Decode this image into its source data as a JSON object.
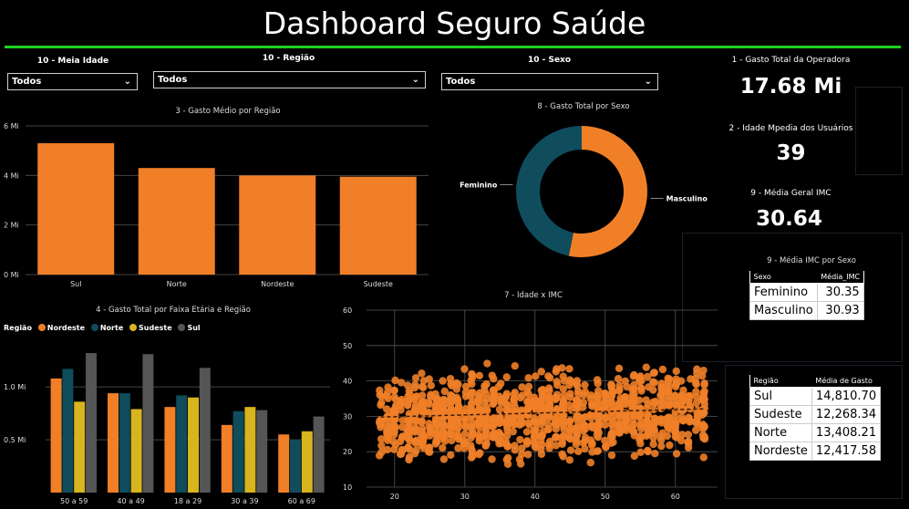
{
  "header": {
    "title": "Dashboard Seguro Saúde"
  },
  "colors": {
    "accent_line": "#20d020",
    "orange": "#f07f28",
    "teal": "#0f4c5c",
    "gold": "#d8b41e",
    "gray": "#555555"
  },
  "slicers": [
    {
      "label": "10 - Meia Idade",
      "value": "Todos"
    },
    {
      "label": "10 - Região",
      "value": "Todos"
    },
    {
      "label": "10 - Sexo",
      "value": "Todos"
    }
  ],
  "cards": [
    {
      "label": "1 - Gasto Total da Operadora",
      "value": "17.68 Mi"
    },
    {
      "label": "2 - Idade Mpedia dos Usuários",
      "value": "39"
    },
    {
      "label": "9 - Média Geral IMC",
      "value": "30.64"
    }
  ],
  "charts": {
    "region_avg": {
      "title": "3 - Gasto Médio por Região"
    },
    "sex_total": {
      "title": "8 - Gasto Total por Sexo"
    },
    "age_region": {
      "title": "4 - Gasto Total por Faixa Etária e Região",
      "legend_title": "Região"
    },
    "scatter": {
      "title": "7 - Idade x IMC"
    }
  },
  "tables": {
    "imc_sexo": {
      "title": "9 - Média IMC por Sexo",
      "headers": [
        "Sexo",
        "Média_IMC"
      ],
      "rows": [
        [
          "Feminino",
          "30.35"
        ],
        [
          "Masculino",
          "30.93"
        ]
      ]
    },
    "gasto_regiao": {
      "headers": [
        "Região",
        "Média de Gasto"
      ],
      "rows": [
        [
          "Sul",
          "14,810.70"
        ],
        [
          "Sudeste",
          "12,268.34"
        ],
        [
          "Norte",
          "13,408.21"
        ],
        [
          "Nordeste",
          "12,417.58"
        ]
      ]
    }
  },
  "chart_data": [
    {
      "type": "bar",
      "title": "3 - Gasto Médio por Região",
      "categories": [
        "Sul",
        "Norte",
        "Nordeste",
        "Sudeste"
      ],
      "values": [
        5.3,
        4.3,
        4.0,
        3.95
      ],
      "unit": "Mi",
      "yticks": [
        "0 Mi",
        "2 Mi",
        "4 Mi",
        "6 Mi"
      ],
      "ylim": [
        0,
        6
      ],
      "grid": true
    },
    {
      "type": "pie",
      "donut": true,
      "title": "8 - Gasto Total por Sexo",
      "labels": [
        "Masculino",
        "Feminino"
      ],
      "values": [
        9.4,
        8.28
      ],
      "colors": [
        "#f07f28",
        "#0f4c5c"
      ]
    },
    {
      "type": "bar",
      "title": "4 - Gasto Total por Faixa Etária e Região",
      "legend_title": "Região",
      "categories": [
        "50 a 59",
        "40 a 49",
        "18 a 29",
        "30 a 39",
        "60 a 69"
      ],
      "yticks": [
        "0.5 Mi",
        "1.0 Mi"
      ],
      "ylim": [
        0,
        1.45
      ],
      "grid": true,
      "series": [
        {
          "name": "Nordeste",
          "color": "#f07f28",
          "values": [
            1.08,
            0.94,
            0.81,
            0.64,
            0.55
          ]
        },
        {
          "name": "Norte",
          "color": "#0f4c5c",
          "values": [
            1.17,
            0.94,
            0.92,
            0.77,
            0.5
          ]
        },
        {
          "name": "Sudeste",
          "color": "#d8b41e",
          "values": [
            0.86,
            0.79,
            0.9,
            0.81,
            0.58
          ]
        },
        {
          "name": "Sul",
          "color": "#555555",
          "values": [
            1.32,
            1.31,
            1.18,
            0.78,
            0.72
          ]
        }
      ]
    },
    {
      "type": "scatter",
      "title": "7 - Idade x IMC",
      "xlim": [
        16,
        66
      ],
      "ylim": [
        10,
        60
      ],
      "xticks": [
        "20",
        "30",
        "40",
        "50",
        "60"
      ],
      "yticks": [
        "10",
        "20",
        "30",
        "40",
        "50",
        "60"
      ],
      "grid": true,
      "series": [
        {
          "color": "#f07f28",
          "x_range": [
            18,
            64
          ],
          "y_center": [
            29.5,
            32
          ],
          "trend": [
            [
              18,
              29.8
            ],
            [
              64,
              32.1
            ]
          ]
        }
      ]
    }
  ]
}
